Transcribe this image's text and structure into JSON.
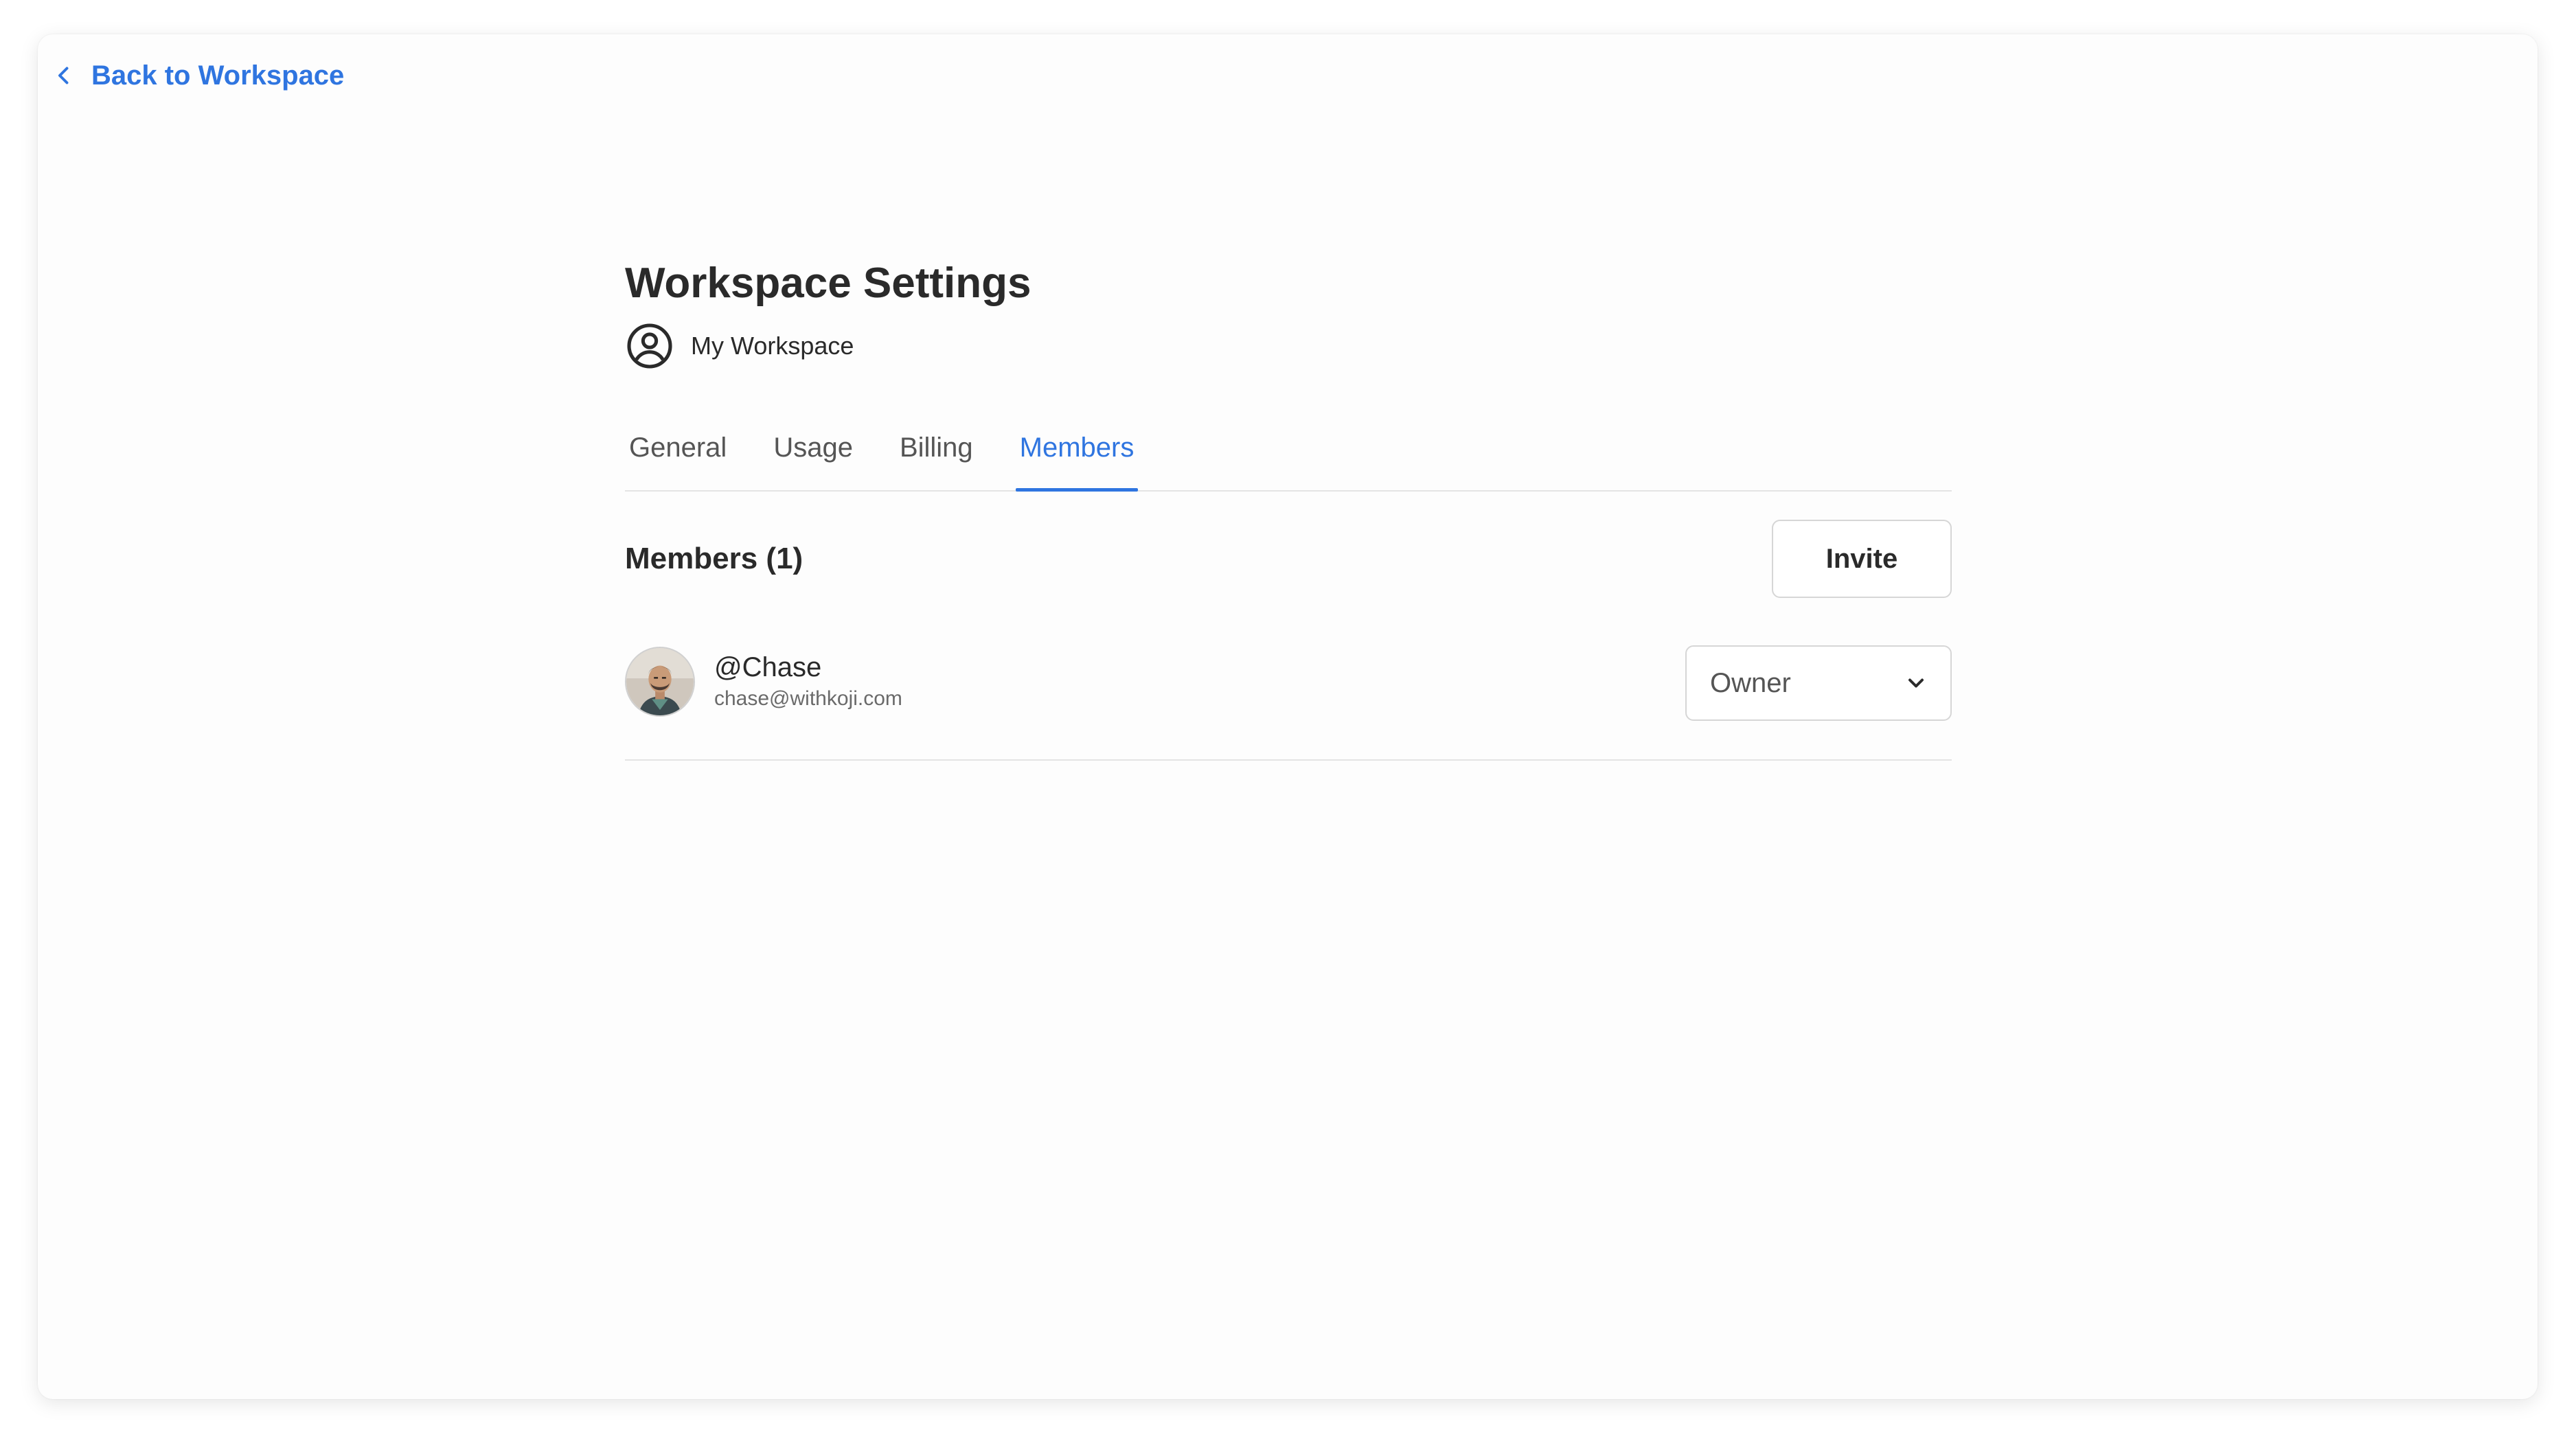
{
  "nav": {
    "back_label": "Back to Workspace",
    "back_icon": "chevron-left-icon"
  },
  "page": {
    "title": "Workspace Settings",
    "workspace_icon": "user-circle-icon",
    "workspace_name": "My Workspace"
  },
  "tabs": [
    {
      "label": "General",
      "active": false
    },
    {
      "label": "Usage",
      "active": false
    },
    {
      "label": "Billing",
      "active": false
    },
    {
      "label": "Members",
      "active": true
    }
  ],
  "members": {
    "title": "Members (1)",
    "invite_label": "Invite",
    "list": [
      {
        "handle": "@Chase",
        "email": "chase@withkoji.com",
        "role": "Owner",
        "role_icon": "chevron-down-icon"
      }
    ]
  },
  "colors": {
    "accent": "#2f75e0",
    "text": "#2a2a2a",
    "border": "#d6d6d6",
    "divider": "#e4e4e4",
    "background": "#fdfdfd"
  }
}
